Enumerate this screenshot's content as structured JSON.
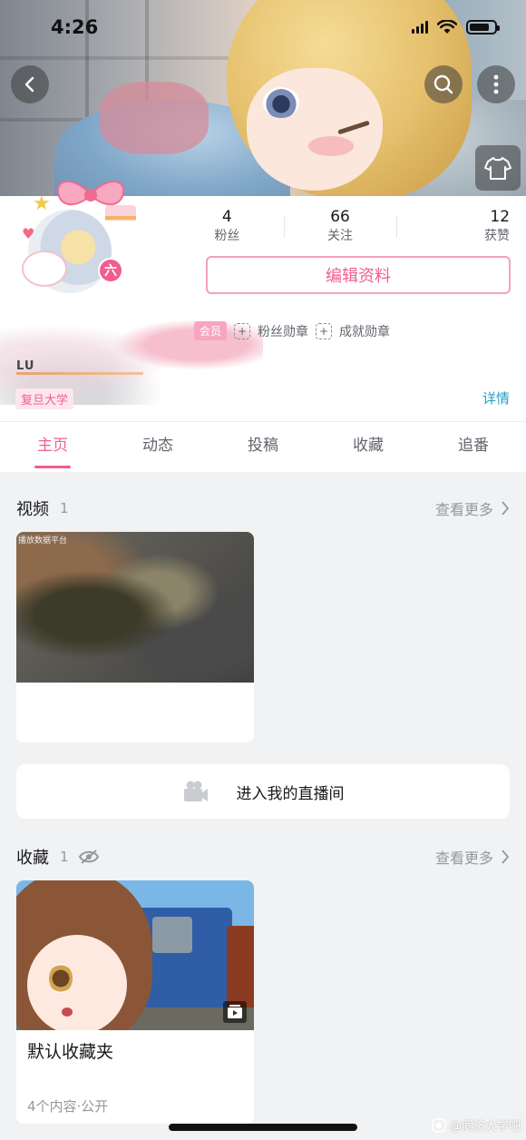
{
  "status_bar": {
    "time": "4:26"
  },
  "profile": {
    "level_badge": "六",
    "stats": [
      {
        "value": "4",
        "label": "粉丝"
      },
      {
        "value": "66",
        "label": "关注"
      },
      {
        "value": "12",
        "label": "获赞"
      }
    ],
    "edit_button": "编辑资料",
    "vip_tag": "会员",
    "fan_medal": "粉丝勋章",
    "achievement_medal": "成就勋章",
    "name_fragment": "LU",
    "school_tag": "复旦大学",
    "detail_link": "详情"
  },
  "tabs": [
    {
      "label": "主页",
      "active": true
    },
    {
      "label": "动态",
      "active": false
    },
    {
      "label": "投稿",
      "active": false
    },
    {
      "label": "收藏",
      "active": false
    },
    {
      "label": "追番",
      "active": false
    }
  ],
  "videos_section": {
    "title": "视频",
    "count": "1",
    "more": "查看更多",
    "video_watermark": "播放数据平台"
  },
  "live_room_button": "进入我的直播间",
  "favorites_section": {
    "title": "收藏",
    "count": "1",
    "more": "查看更多",
    "folder_title": "默认收藏夹",
    "folder_meta": "4个内容·公开"
  },
  "watermark": "@同济大学吧",
  "colors": {
    "accent": "#f25d8e",
    "link": "#20a0c9"
  },
  "icons": [
    "back-icon",
    "search-icon",
    "more-icon",
    "dress-up-icon",
    "camera-icon",
    "eye-off-icon",
    "chevron-right-icon",
    "playlist-icon"
  ]
}
